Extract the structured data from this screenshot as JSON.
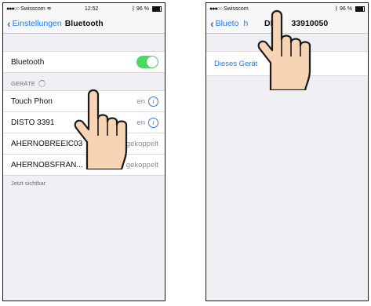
{
  "left_screen": {
    "status": {
      "carrier": "Swisscom",
      "time": "12:52",
      "battery": "96 %"
    },
    "nav": {
      "back_label": "Einstellungen",
      "title": "Bluetooth"
    },
    "bluetooth_row": {
      "label": "Bluetooth",
      "toggle_on": true
    },
    "devices_header": "GERÄTE",
    "devices": [
      {
        "name": "Touch Phon",
        "status": "en"
      },
      {
        "name": "DISTO 3391",
        "status": "en"
      },
      {
        "name": "AHERNOBRE",
        "overlay": "EIC03",
        "status": "gekoppelt"
      },
      {
        "name": "AHERNOBSFRAN...",
        "status": "Nicht gekoppelt"
      }
    ],
    "footer": "Jetzt sichtbar"
  },
  "right_screen": {
    "status": {
      "carrier": "Swisscom",
      "battery": "96 %"
    },
    "nav": {
      "back_label": "Blueto",
      "back_label_tail": "h",
      "title_part1": "DIS",
      "title_part2": "33910050"
    },
    "forget_device": "Dieses Gerät"
  },
  "colors": {
    "accent": "#1a7cf6",
    "toggle_on": "#4cd964",
    "hand_fill": "#f6d4b4"
  }
}
